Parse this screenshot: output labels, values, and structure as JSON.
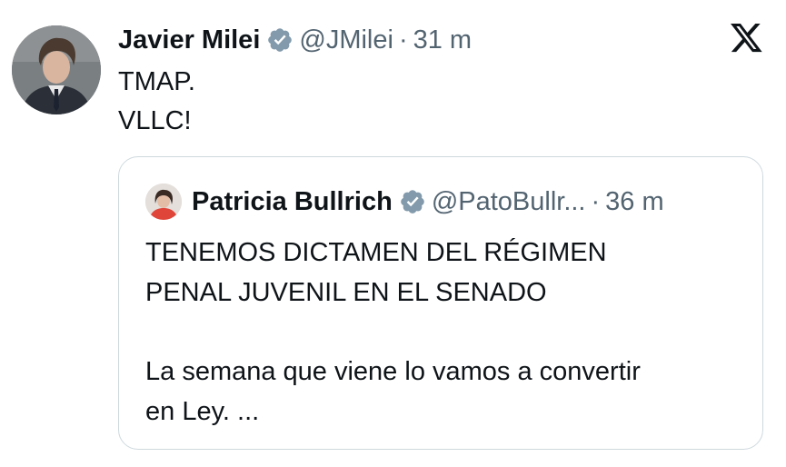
{
  "tweet": {
    "author_name": "Javier Milei",
    "author_handle": "@JMilei",
    "separator": "·",
    "time": "31 m",
    "text_lines": [
      "TMAP.",
      "VLLC!"
    ]
  },
  "quoted_tweet": {
    "author_name": "Patricia Bullrich",
    "author_handle": "@PatoBullr...",
    "separator": "·",
    "time": "36 m",
    "text_lines": [
      "TENEMOS DICTAMEN DEL RÉGIMEN",
      "PENAL JUVENIL EN EL SENADO",
      "La semana que viene lo vamos a convertir",
      "en Ley. ..."
    ]
  },
  "icons": {
    "verified": "verified-badge-icon",
    "brand": "x-logo-icon"
  },
  "colors": {
    "text": "#0f1419",
    "secondary": "#536471",
    "verified_badge": "#829aab",
    "quote_border": "#cfd9de"
  }
}
